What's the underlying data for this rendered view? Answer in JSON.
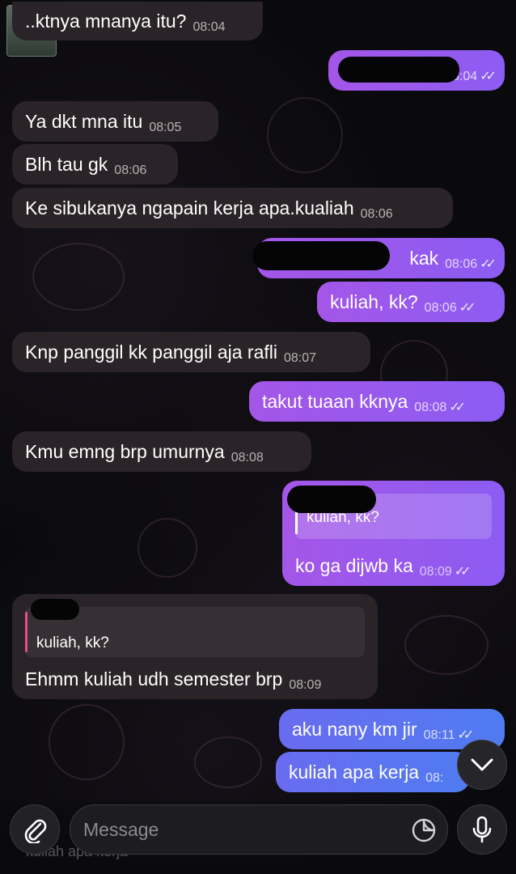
{
  "messages": [
    {
      "id": "m1",
      "side": "in",
      "text": "..ktnya mnanya itu?",
      "time": "08:04"
    },
    {
      "id": "m2",
      "side": "out",
      "text": "",
      "time": "08:04",
      "redacted": true
    },
    {
      "id": "m3",
      "side": "in",
      "text": "Ya dkt mna itu",
      "time": "08:05"
    },
    {
      "id": "m4",
      "side": "in",
      "text": "Blh tau gk",
      "time": "08:06"
    },
    {
      "id": "m5",
      "side": "in",
      "text": "Ke sibukanya ngapain kerja apa.kualiah",
      "time": "08:06"
    },
    {
      "id": "m6",
      "side": "out",
      "text": "kak",
      "time": "08:06",
      "redacted": true
    },
    {
      "id": "m7",
      "side": "out",
      "text": "kuliah, kk?",
      "time": "08:06"
    },
    {
      "id": "m8",
      "side": "in",
      "text": "Knp panggil kk panggil aja rafli",
      "time": "08:07"
    },
    {
      "id": "m9",
      "side": "out",
      "text": "takut tuaan kknya",
      "time": "08:08"
    },
    {
      "id": "m10",
      "side": "in",
      "text": "Kmu emng brp umurnya",
      "time": "08:08"
    },
    {
      "id": "m11",
      "side": "out",
      "text": "ko ga dijwb ka",
      "time": "08:09",
      "reply_to": "kuliah, kk?"
    },
    {
      "id": "m12",
      "side": "in",
      "text": "Ehmm kuliah udh semester brp",
      "time": "08:09",
      "reply_to": "kuliah, kk?"
    },
    {
      "id": "m13",
      "side": "out",
      "text": "aku nany km jir",
      "time": "08:11"
    },
    {
      "id": "m14",
      "side": "out",
      "text": "kuliah apa kerja",
      "time": "08:"
    }
  ],
  "composer": {
    "placeholder": "Message",
    "reply_preview": "kuliah apa kerja"
  },
  "icons": {
    "attach": "paperclip-icon",
    "sticker": "sticker-icon",
    "mic": "microphone-icon",
    "scroll": "chevron-down-icon",
    "read": "double-check-icon"
  },
  "colors": {
    "outgoing_bubble": "#9a58ec",
    "outgoing_bubble_last": "#5b74f0",
    "incoming_bubble": "#2a2327",
    "background": "#0a0a0c"
  }
}
